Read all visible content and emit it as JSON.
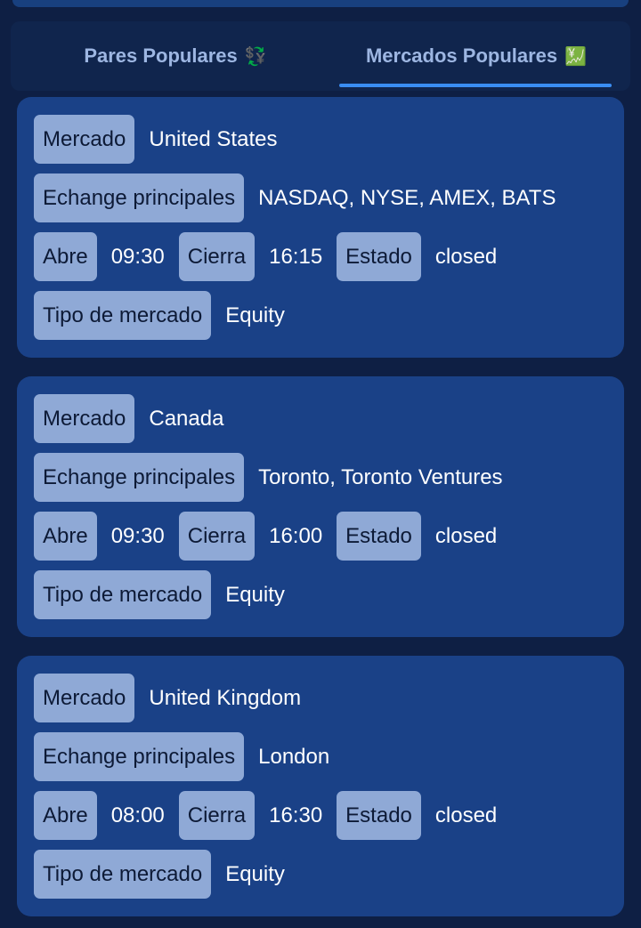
{
  "tabs": {
    "pares": {
      "label": "Pares Populares",
      "emoji": "💱"
    },
    "mercados": {
      "label": "Mercados Populares",
      "emoji": "💹"
    }
  },
  "field_labels": {
    "market": "Mercado",
    "exchanges": "Echange principales",
    "opens": "Abre",
    "closes": "Cierra",
    "status": "Estado",
    "market_type": "Tipo de mercado"
  },
  "markets": [
    {
      "name": "United States",
      "exchanges": "NASDAQ, NYSE, AMEX, BATS",
      "opens": "09:30",
      "closes": "16:15",
      "status": "closed",
      "type": "Equity"
    },
    {
      "name": "Canada",
      "exchanges": "Toronto, Toronto Ventures",
      "opens": "09:30",
      "closes": "16:00",
      "status": "closed",
      "type": "Equity"
    },
    {
      "name": "United Kingdom",
      "exchanges": "London",
      "opens": "08:00",
      "closes": "16:30",
      "status": "closed",
      "type": "Equity"
    }
  ],
  "colors": {
    "background": "#0e1f44",
    "card": "#1a4187",
    "label_bg": "#8fa9d6",
    "accent": "#3a8df2"
  }
}
